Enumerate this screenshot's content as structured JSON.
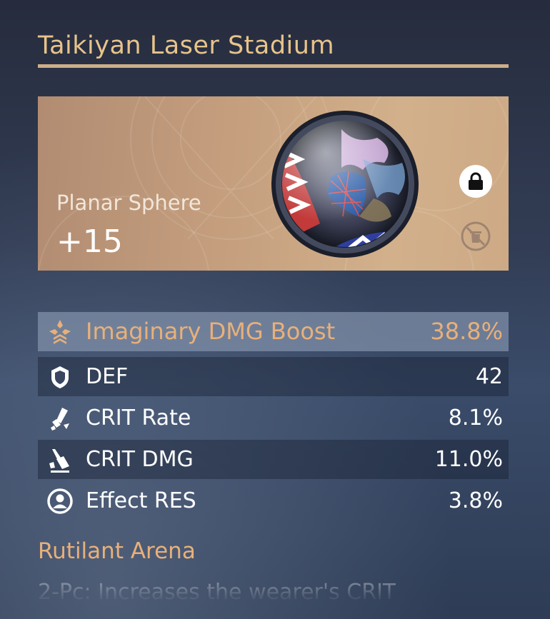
{
  "relic": {
    "name": "Taikiyan Laser Stadium",
    "type": "Planar Sphere",
    "level": "+15",
    "icon": "sphere-icon"
  },
  "actions": {
    "lock_icon": "lock-icon",
    "discard_icon": "trash-icon"
  },
  "main_stat": {
    "label": "Imaginary DMG Boost",
    "value": "38.8%",
    "icon": "imaginary-icon"
  },
  "sub_stats": [
    {
      "label": "DEF",
      "value": "42",
      "icon": "shield-icon"
    },
    {
      "label": "CRIT Rate",
      "value": "8.1%",
      "icon": "crit-rate-icon"
    },
    {
      "label": "CRIT DMG",
      "value": "11.0%",
      "icon": "crit-dmg-icon"
    },
    {
      "label": "Effect RES",
      "value": "3.8%",
      "icon": "effect-res-icon"
    }
  ],
  "set": {
    "name": "Rutilant Arena",
    "description": "2-Pc: Increases the wearer's CRIT"
  },
  "colors": {
    "title": "#e8c38a",
    "accent": "#e8b07a",
    "card": "#c49e7d",
    "background": "#323d55"
  }
}
